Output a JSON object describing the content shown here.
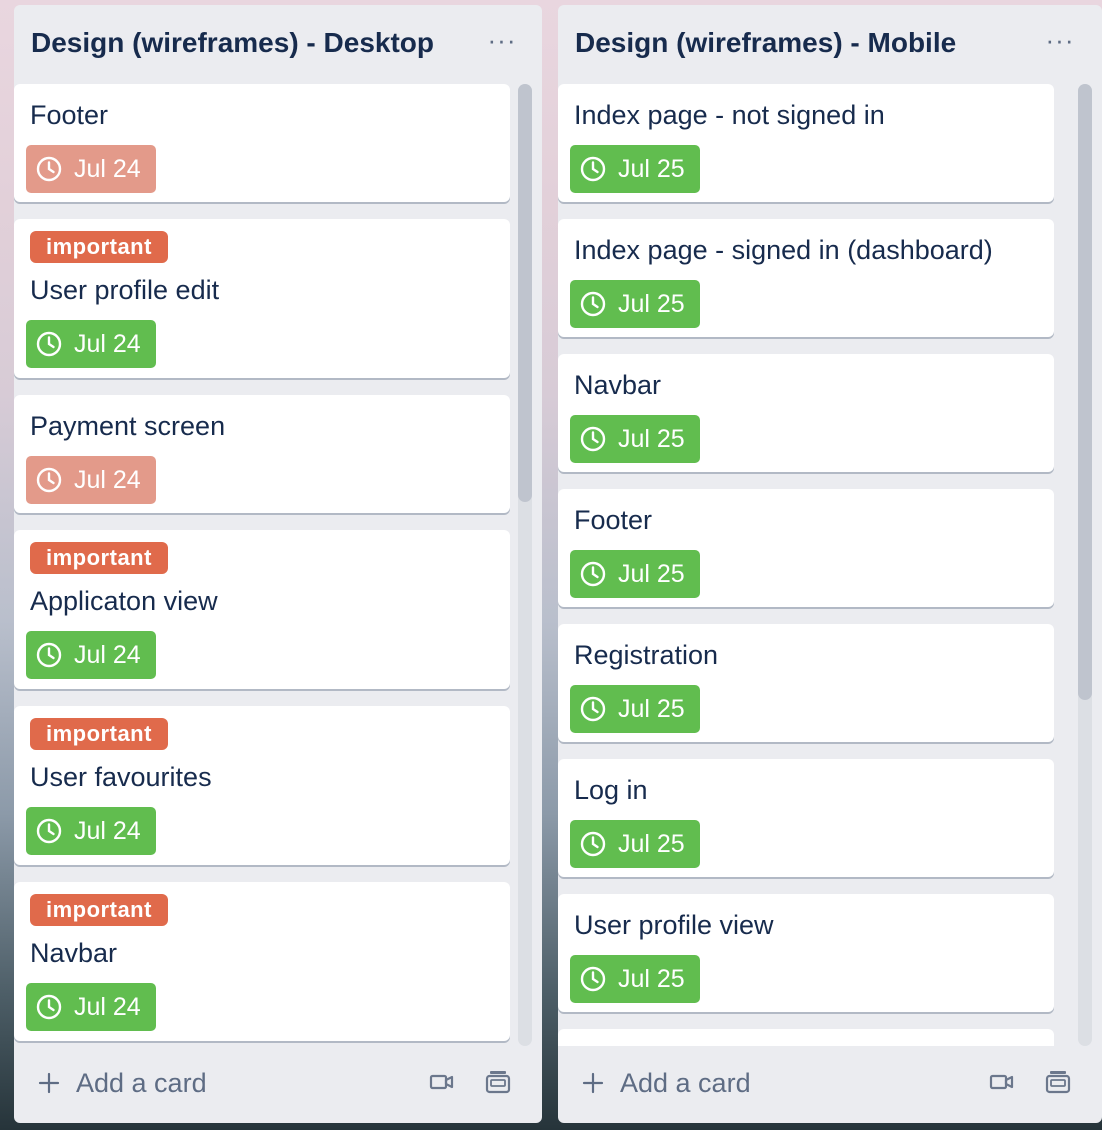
{
  "lists": [
    {
      "title": "Design (wireframes) - Desktop",
      "menu_glyph": "···",
      "cards": [
        {
          "title": "Footer",
          "label": "",
          "due": "Jul 24",
          "due_status": "overdue"
        },
        {
          "title": "User profile edit",
          "label": "important",
          "due": "Jul 24",
          "due_status": "upcoming"
        },
        {
          "title": "Payment screen",
          "label": "",
          "due": "Jul 24",
          "due_status": "overdue"
        },
        {
          "title": "Applicaton view",
          "label": "important",
          "due": "Jul 24",
          "due_status": "upcoming"
        },
        {
          "title": "User favourites",
          "label": "important",
          "due": "Jul 24",
          "due_status": "upcoming"
        },
        {
          "title": "Navbar",
          "label": "important",
          "due": "Jul 24",
          "due_status": "upcoming"
        }
      ],
      "add_card_label": "Add a card"
    },
    {
      "title": "Design (wireframes) - Mobile",
      "menu_glyph": "···",
      "cards": [
        {
          "title": "Index page - not signed in",
          "label": "",
          "due": "Jul 25",
          "due_status": "upcoming"
        },
        {
          "title": "Index page - signed in (dashboard)",
          "label": "",
          "due": "Jul 25",
          "due_status": "upcoming"
        },
        {
          "title": "Navbar",
          "label": "",
          "due": "Jul 25",
          "due_status": "upcoming"
        },
        {
          "title": "Footer",
          "label": "",
          "due": "Jul 25",
          "due_status": "upcoming"
        },
        {
          "title": "Registration",
          "label": "",
          "due": "Jul 25",
          "due_status": "upcoming"
        },
        {
          "title": "Log in",
          "label": "",
          "due": "Jul 25",
          "due_status": "upcoming"
        },
        {
          "title": "User profile view",
          "label": "",
          "due": "Jul 25",
          "due_status": "upcoming"
        },
        {
          "title": "",
          "label": "",
          "due": "",
          "due_status": "hidden"
        }
      ],
      "add_card_label": "Add a card"
    }
  ],
  "colors": {
    "label_important": "#e06a4b",
    "due_upcoming": "#61bd4f",
    "due_overdue": "#e39a8a",
    "list_background": "#ebecf0"
  },
  "icons": {
    "due": "clock-icon",
    "menu": "ellipsis-icon",
    "add": "plus-icon",
    "video": "video-camera-icon",
    "template": "card-template-icon"
  }
}
